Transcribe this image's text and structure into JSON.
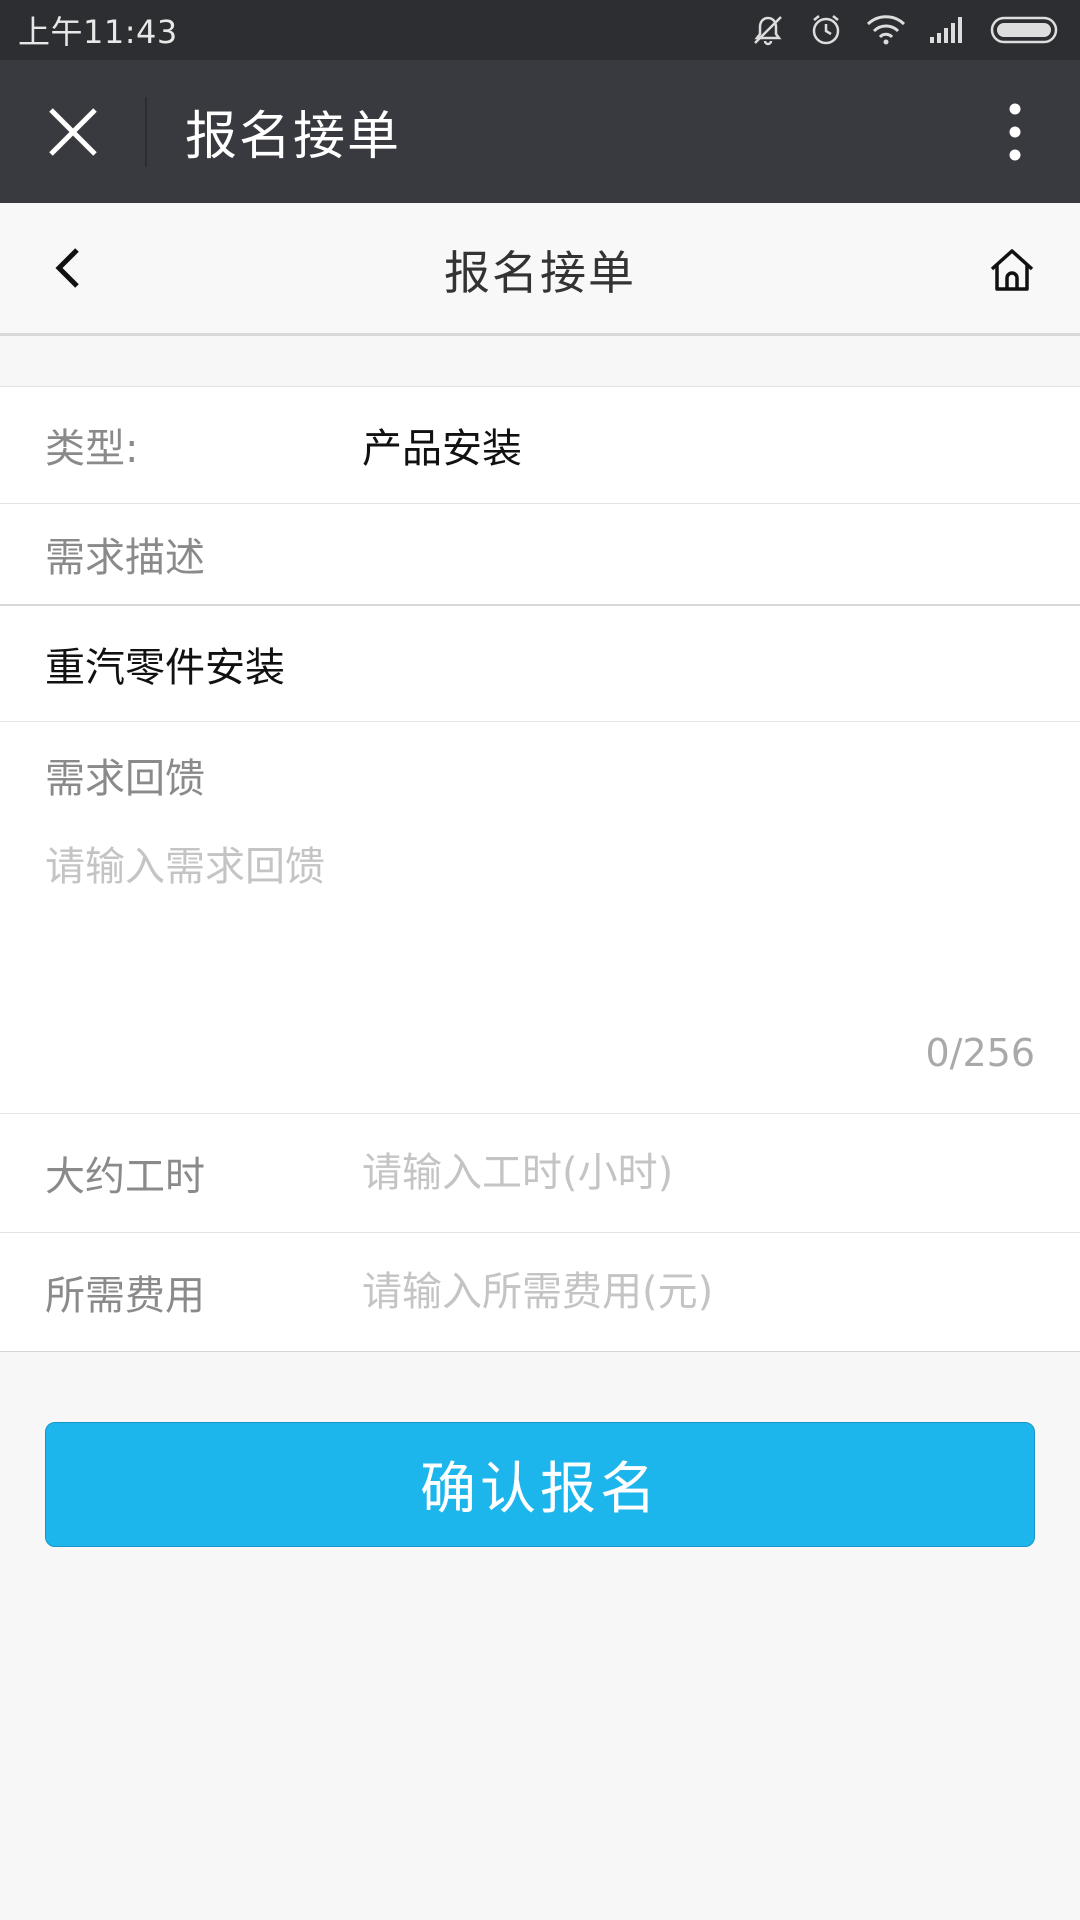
{
  "status_bar": {
    "time": "上午11:43",
    "icons": [
      "mute-icon",
      "alarm-icon",
      "wifi-icon",
      "signal-icon",
      "battery-icon"
    ]
  },
  "title_bar": {
    "title": "报名接单",
    "close_icon": "close-icon",
    "more_icon": "more-vertical-icon"
  },
  "page_header": {
    "title": "报名接单",
    "back_icon": "chevron-left-icon",
    "home_icon": "home-icon"
  },
  "form": {
    "type_label": "类型:",
    "type_value": "产品安装",
    "desc_label": "需求描述",
    "desc_value": "重汽零件安装",
    "feedback_label": "需求回馈",
    "feedback_placeholder": "请输入需求回馈",
    "feedback_value": "",
    "feedback_counter": "0/256",
    "hours_label": "大约工时",
    "hours_placeholder": "请输入工时(小时)",
    "cost_label": "所需费用",
    "cost_placeholder": "请输入所需费用(元)"
  },
  "submit_label": "确认报名",
  "colors": {
    "status_bar_bg": "#2d2e32",
    "title_bar_bg": "#393a3f",
    "accent": "#1cb5ec",
    "page_bg": "#f7f7f7"
  }
}
